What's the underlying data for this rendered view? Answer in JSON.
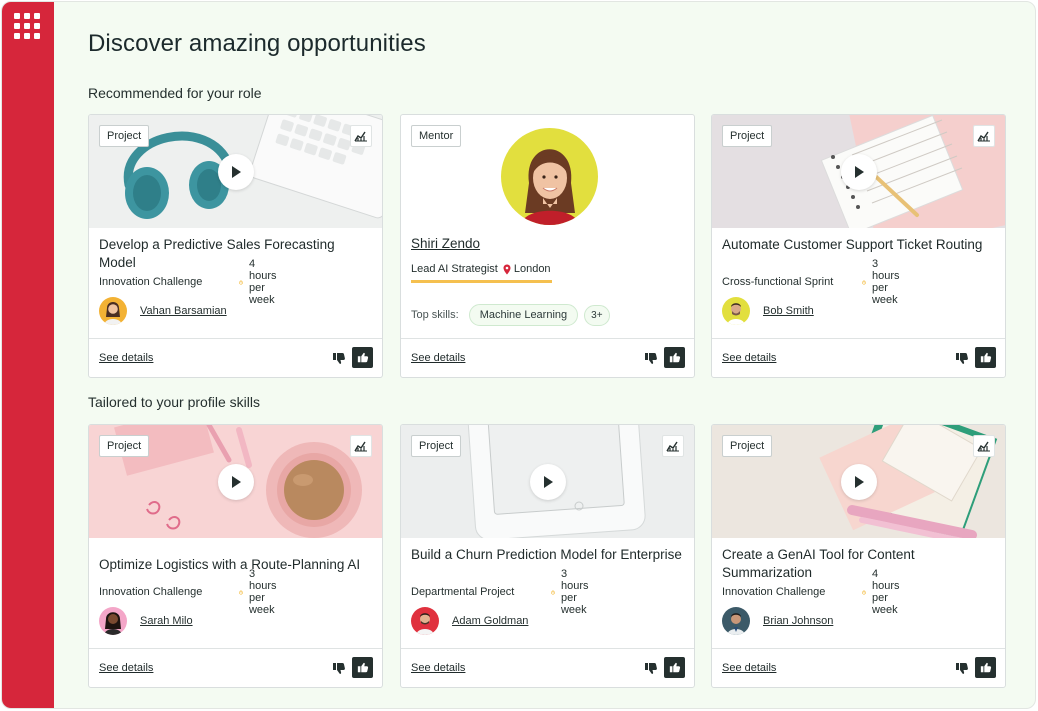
{
  "page": {
    "title": "Discover amazing opportunities",
    "sections": [
      "Recommended for your role",
      "Tailored to your profile skills"
    ]
  },
  "cards": [
    {
      "type": "Project",
      "title": "Develop a Predictive Sales Forecasting Model",
      "category": "Innovation Challenge",
      "hours": "4 hours per week",
      "person": "Vahan Barsamian",
      "see_details": "See details"
    },
    {
      "type": "Mentor",
      "name": "Shiri Zendo",
      "role": "Lead AI Strategist",
      "location": "London",
      "skills_label": "Top skills:",
      "skill": "Machine Learning",
      "more": "3+",
      "see_details": "See details"
    },
    {
      "type": "Project",
      "title": "Automate Customer Support Ticket Routing",
      "category": "Cross-functional Sprint",
      "hours": "3 hours per week",
      "person": "Bob Smith",
      "see_details": "See details"
    },
    {
      "type": "Project",
      "title": "Optimize Logistics with a Route-Planning AI",
      "category": "Innovation Challenge",
      "hours": "3 hours per week",
      "person": "Sarah Milo",
      "see_details": "See details"
    },
    {
      "type": "Project",
      "title": "Build a Churn Prediction Model for Enterprise",
      "category": "Departmental Project",
      "hours": "3 hours per week",
      "person": "Adam Goldman",
      "see_details": "See details"
    },
    {
      "type": "Project",
      "title": "Create a GenAI Tool for Content Summarization",
      "category": "Innovation Challenge",
      "hours": "4 hours per week",
      "person": "Brian Johnson",
      "see_details": "See details"
    }
  ],
  "colors": {
    "rail": "#d6263b",
    "accent_dark": "#25302f",
    "underline_accent": "#f5c04f",
    "clock_icon": "#f0a500"
  },
  "icons": [
    "apps-grid-icon",
    "analytics-icon",
    "play-icon",
    "clock-icon",
    "location-pin-icon",
    "thumbs-down-icon",
    "thumbs-up-icon"
  ]
}
